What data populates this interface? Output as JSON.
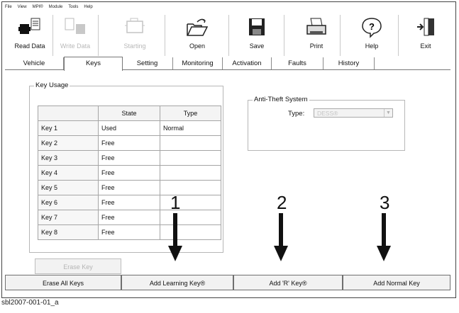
{
  "menu": [
    "File",
    "View",
    "MPI®",
    "Module",
    "Tools",
    "Help"
  ],
  "toolbar": {
    "read_data": "Read Data",
    "write_data": "Write Data",
    "starting": "Starting",
    "open": "Open",
    "save": "Save",
    "print": "Print",
    "help": "Help",
    "exit": "Exit"
  },
  "tabs": [
    "Vehicle",
    "Keys",
    "Setting",
    "Monitoring",
    "Activation",
    "Faults",
    "History"
  ],
  "key_usage": {
    "title": "Key Usage",
    "headers": {
      "state": "State",
      "type": "Type"
    },
    "rows": [
      {
        "key": "Key 1",
        "state": "Used",
        "type": "Normal"
      },
      {
        "key": "Key 2",
        "state": "Free",
        "type": ""
      },
      {
        "key": "Key 3",
        "state": "Free",
        "type": ""
      },
      {
        "key": "Key 4",
        "state": "Free",
        "type": ""
      },
      {
        "key": "Key 5",
        "state": "Free",
        "type": ""
      },
      {
        "key": "Key 6",
        "state": "Free",
        "type": ""
      },
      {
        "key": "Key 7",
        "state": "Free",
        "type": ""
      },
      {
        "key": "Key 8",
        "state": "Free",
        "type": ""
      }
    ]
  },
  "anti_theft": {
    "title": "Anti-Theft System",
    "type_label": "Type:",
    "type_value": "DESS®"
  },
  "buttons": {
    "erase_key": "Erase Key",
    "erase_all": "Erase All Keys",
    "add_learning": "Add Learning Key®",
    "add_r": "Add 'R' Key®",
    "add_normal": "Add Normal Key"
  },
  "callouts": [
    "1",
    "2",
    "3"
  ],
  "caption": "sbl2007-001-01_a"
}
